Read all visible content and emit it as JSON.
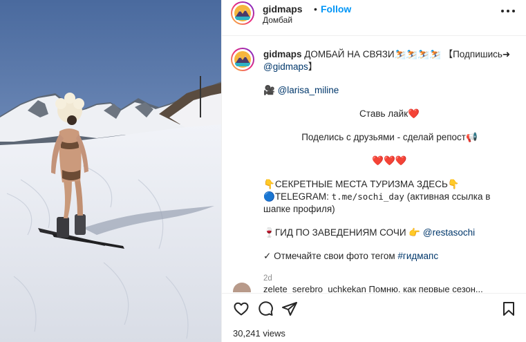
{
  "post": {
    "username": "gidmaps",
    "dot": "•",
    "follow_label": "Follow",
    "location": "Домбай",
    "more_label": "•••"
  },
  "caption": {
    "username": "gidmaps",
    "line1": "ДОМБАЙ НА СВЯЗИ⛷️⛷️⛷️⛷️ 【Подпишись➜",
    "line1_link": "@gidmaps",
    "line1_end": "】",
    "credit_emoji": "🎥",
    "credit_link": "@larisa_miline",
    "like_text": "Ставь лайк",
    "like_heart": "❤️",
    "share_text": "Поделись с друзьями - сделай репост",
    "share_emoji": "📢",
    "hearts": "❤️❤️❤️",
    "secret_emoji": "👇",
    "secret_text": "СЕКРЕТНЫЕ МЕСТА ТУРИЗМА ЗДЕСЬ",
    "secret_emoji2": "👇",
    "tg_emoji": "🔵",
    "tg_label": "TELEGRAM:",
    "tg_link": "t.me/sochi_day",
    "tg_note": "(активная ссылка в шапке профиля)",
    "guide_emoji": "🍷",
    "guide_text": "ГИД ПО ЗАВЕДЕНИЯМ СОЧИ",
    "guide_emoji2": "👉",
    "guide_link": "@restasochi",
    "tag_check": "✓",
    "tag_text": "Отмечайте свои фото тегом",
    "tag_link": "#гидмапс",
    "time": "2d"
  },
  "comment": {
    "text": "zelete_serebro_uchkekan Помню, как первые сезон..."
  },
  "actions": {
    "like_icon": "heart-outline-icon",
    "comment_icon": "speech-bubble-icon",
    "share_icon": "paper-plane-icon",
    "save_icon": "bookmark-icon",
    "views": "30,241 views"
  }
}
